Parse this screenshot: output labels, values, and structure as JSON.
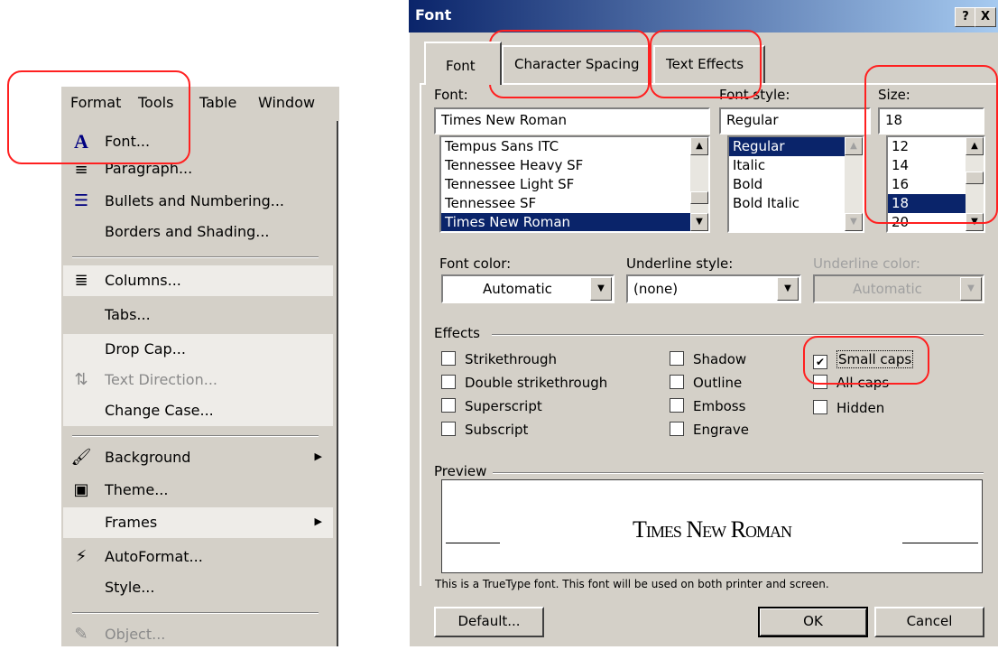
{
  "menu": {
    "bar": [
      "Format",
      "Tools",
      "Table",
      "Window"
    ],
    "items": [
      {
        "label": "Font...",
        "icon": "font-A-icon"
      },
      {
        "label": "Paragraph...",
        "icon": "paragraph-icon"
      },
      {
        "label": "Bullets and Numbering...",
        "icon": "bullets-icon"
      },
      {
        "label": "Borders and Shading...",
        "icon": ""
      },
      {
        "label": "Columns...",
        "icon": "columns-icon"
      },
      {
        "label": "Tabs...",
        "icon": ""
      },
      {
        "label": "Drop Cap...",
        "icon": ""
      },
      {
        "label": "Text Direction...",
        "icon": "text-direction-icon"
      },
      {
        "label": "Change Case...",
        "icon": ""
      },
      {
        "label": "Background",
        "icon": "background-icon"
      },
      {
        "label": "Theme...",
        "icon": "theme-icon"
      },
      {
        "label": "Frames",
        "icon": ""
      },
      {
        "label": "AutoFormat...",
        "icon": "autoformat-icon"
      },
      {
        "label": "Style...",
        "icon": ""
      },
      {
        "label": "Object...",
        "icon": "object-icon"
      }
    ]
  },
  "dialog": {
    "title": "Font",
    "help_btn": "?",
    "close_btn": "X",
    "tabs": [
      "Font",
      "Character Spacing",
      "Text Effects"
    ],
    "font_label": "Font:",
    "font_value": "Times New Roman",
    "font_list": [
      "Tempus Sans ITC",
      "Tennessee Heavy SF",
      "Tennessee Light SF",
      "Tennessee SF",
      "Times New Roman"
    ],
    "style_label": "Font style:",
    "style_value": "Regular",
    "style_list": [
      "Regular",
      "Italic",
      "Bold",
      "Bold Italic"
    ],
    "size_label": "Size:",
    "size_value": "18",
    "size_list": [
      "12",
      "14",
      "16",
      "18",
      "20"
    ],
    "font_color_label": "Font color:",
    "font_color_value": "Automatic",
    "underline_style_label": "Underline style:",
    "underline_style_value": "(none)",
    "underline_color_label": "Underline color:",
    "underline_color_value": "Automatic",
    "effects_label": "Effects",
    "effects": {
      "strikethrough": "Strikethrough",
      "double_strikethrough": "Double strikethrough",
      "superscript": "Superscript",
      "subscript": "Subscript",
      "shadow": "Shadow",
      "outline": "Outline",
      "emboss": "Emboss",
      "engrave": "Engrave",
      "small_caps": "Small caps",
      "all_caps": "All caps",
      "hidden": "Hidden"
    },
    "preview_label": "Preview",
    "preview_text": "Times New Roman",
    "info_text": "This is a TrueType font. This font will be used on both printer and screen.",
    "default_btn": "Default...",
    "ok_btn": "OK",
    "cancel_btn": "Cancel"
  }
}
